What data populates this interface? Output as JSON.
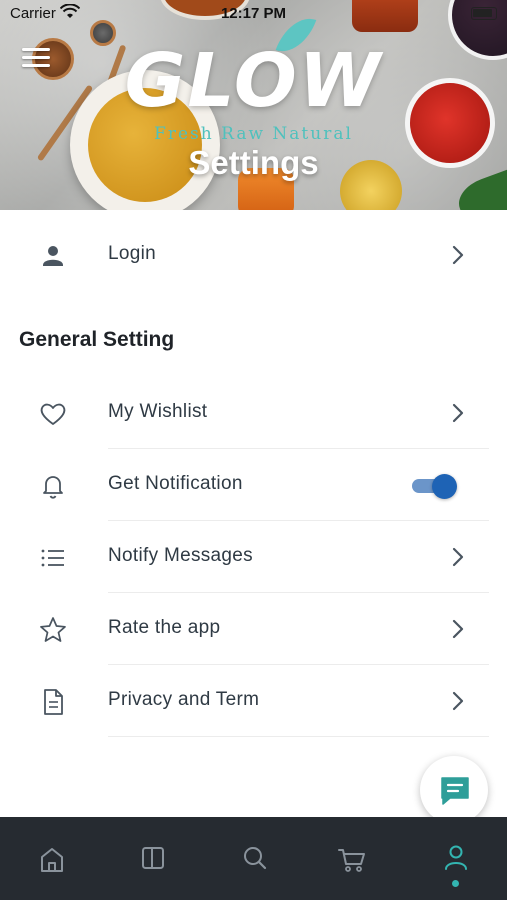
{
  "status_bar": {
    "carrier": "Carrier",
    "time": "12:17 PM"
  },
  "header": {
    "logo_text": "GLOW",
    "tagline": "Fresh Raw Natural",
    "page_title": "Settings"
  },
  "account": {
    "login_label": "Login",
    "icon": "person-icon"
  },
  "general_setting": {
    "section_title": "General Setting",
    "items": [
      {
        "label": "My Wishlist",
        "icon": "heart-icon",
        "control": "chevron"
      },
      {
        "label": "Get Notification",
        "icon": "bell-icon",
        "control": "toggle",
        "toggle_on": true
      },
      {
        "label": "Notify Messages",
        "icon": "list-icon",
        "control": "chevron"
      },
      {
        "label": "Rate the app",
        "icon": "star-icon",
        "control": "chevron"
      },
      {
        "label": "Privacy and Term",
        "icon": "document-icon",
        "control": "chevron"
      }
    ]
  },
  "chat_fab": {
    "icon": "chat-icon"
  },
  "bottom_nav": {
    "items": [
      {
        "icon": "home-icon",
        "active": false
      },
      {
        "icon": "catalog-icon",
        "active": false
      },
      {
        "icon": "search-icon",
        "active": false
      },
      {
        "icon": "cart-icon",
        "active": false
      },
      {
        "icon": "profile-icon",
        "active": true
      }
    ]
  },
  "colors": {
    "accent": "#33b5b1",
    "toggle_on": "#1e63b5",
    "nav_background": "#262b31",
    "icon_gray": "#4a5560"
  }
}
